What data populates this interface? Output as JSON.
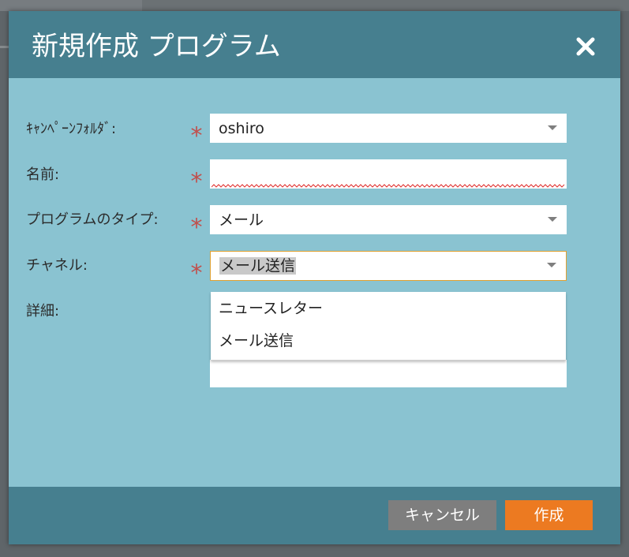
{
  "dialog": {
    "title": "新規作成 プログラム",
    "close_icon": "close-icon"
  },
  "form": {
    "campaign_folder": {
      "label": "ｷｬﾝﾍﾟｰﾝﾌｫﾙﾀﾞ:",
      "value": "oshiro",
      "required": true
    },
    "name": {
      "label": "名前:",
      "value": "",
      "required": true
    },
    "program_type": {
      "label": "プログラムのタイプ:",
      "value": "メール",
      "required": true
    },
    "channel": {
      "label": "チャネル:",
      "value": "メール送信",
      "required": true,
      "options": [
        "ニュースレター",
        "メール送信"
      ]
    },
    "description": {
      "label": "詳細:",
      "value": ""
    }
  },
  "footer": {
    "cancel_label": "キャンセル",
    "create_label": "作成"
  },
  "colors": {
    "header_bg": "#467f8f",
    "body_bg": "#8ac3d1",
    "required_star": "#c0504d",
    "cancel_bg": "#7e7e7e",
    "create_bg": "#ec7a21",
    "focus_border": "#e0a030"
  }
}
